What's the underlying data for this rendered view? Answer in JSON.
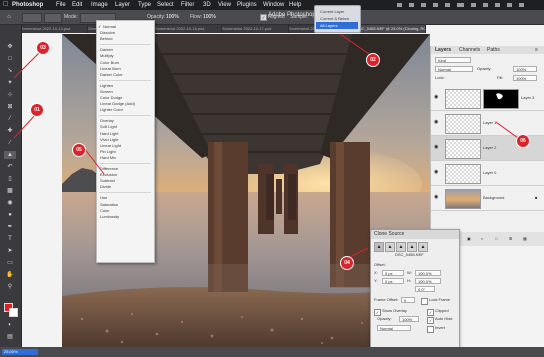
{
  "menubar": {
    "app": "Photoshop",
    "items": [
      "File",
      "Edit",
      "Image",
      "Layer",
      "Type",
      "Select",
      "Filter",
      "3D",
      "View",
      "Plugins",
      "Window",
      "Help"
    ]
  },
  "options_bar": {
    "mode_label": "Mode:",
    "mode_value": "Normal",
    "opacity_label": "Opacity:",
    "opacity_value": "100%",
    "flow_label": "Flow:",
    "flow_value": "100%",
    "aligned_label": "Aligned",
    "sample_label": "Sample:"
  },
  "app_title": "Adobe Photoshop 2023",
  "sample_dropdown": {
    "options": [
      "Current Layer",
      "Current & Below",
      "All Layers"
    ],
    "selected": "All Layers"
  },
  "doc_tabs": [
    "Screenshot 2022-10-14.psd",
    "Screenshot 2022-10-15.psd",
    "Screenshot 2022-10-16.psd",
    "Screenshot 2022-10-17.psd",
    "Screenshot 2022-10-18.psd",
    "DSC_5458.NEF @ 25.0% (Cloning, RGB/8)"
  ],
  "blend_menu": {
    "groups": [
      [
        "Normal",
        "Dissolve",
        "Behind"
      ],
      [
        "Darken",
        "Multiply",
        "Color Burn",
        "Linear Burn",
        "Darker Color"
      ],
      [
        "Lighten",
        "Screen",
        "Color Dodge",
        "Linear Dodge (Add)",
        "Lighter Color"
      ],
      [
        "Overlay",
        "Soft Light",
        "Hard Light",
        "Vivid Light",
        "Linear Light",
        "Pin Light",
        "Hard Mix"
      ],
      [
        "Difference",
        "Exclusion",
        "Subtract",
        "Divide"
      ],
      [
        "Hue",
        "Saturation",
        "Color",
        "Luminosity"
      ]
    ],
    "checked": "Normal",
    "highlighted": "Linear Light"
  },
  "layers_panel": {
    "tabs": [
      "Layers",
      "Channels",
      "Paths"
    ],
    "kind_label": "Kind",
    "blend_value": "Normal",
    "opacity_label": "Opacity:",
    "opacity_value": "100%",
    "lock_label": "Lock:",
    "fill_label": "Fill:",
    "fill_value": "100%",
    "layers": [
      {
        "name": "Layer 3",
        "selected": false
      },
      {
        "name": "Layer 1",
        "selected": false
      },
      {
        "name": "Layer 2",
        "selected": true
      },
      {
        "name": "Layer 0",
        "selected": false
      },
      {
        "name": "Background",
        "selected": false
      }
    ]
  },
  "clone_source": {
    "title": "Clone Source",
    "file": "DSC_5458.NEF",
    "offset_label": "Offset:",
    "w_label": "W:",
    "w_value": "100.0%",
    "h_label": "H:",
    "h_value": "100.0%",
    "x_label": "X:",
    "x_value": "0 px",
    "y_label": "Y:",
    "y_value": "0 px",
    "angle_value": "0.0°",
    "frame_offset_label": "Frame Offset:",
    "frame_offset_value": "0",
    "lock_frame_label": "Lock Frame",
    "show_overlay_label": "Show Overlay",
    "clipped_label": "Clipped",
    "opacity_label": "Opacity:",
    "opacity_value": "100%",
    "auto_hide_label": "Auto Hide",
    "invert_label": "Invert",
    "mode_value": "Normal"
  },
  "status": {
    "zoom": "25.00%"
  },
  "markers": [
    "01",
    "02",
    "03",
    "04",
    "05",
    "06"
  ],
  "colors": {
    "selected_blue": "#2f6ed8",
    "marker_red": "#d8242a",
    "toolbar_bg": "#3b3b3f"
  }
}
